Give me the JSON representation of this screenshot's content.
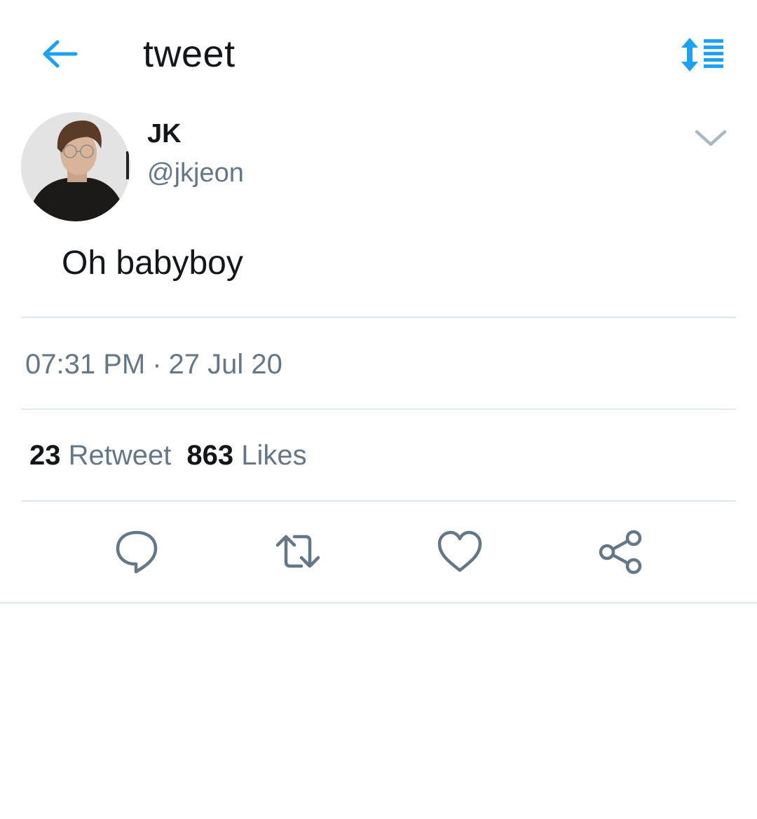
{
  "header": {
    "title": "tweet",
    "back_icon": "arrow-left-icon",
    "sort_icon": "sort-list-icon",
    "accent_color": "#1da1f2"
  },
  "author": {
    "name": "JK",
    "handle": "@jkjeon",
    "avatar_icon": "profile-photo",
    "menu_icon": "chevron-down-icon"
  },
  "tweet": {
    "text": "Oh babyboy",
    "time": "07:31 PM",
    "separator": "·",
    "date": "27 Jul 20"
  },
  "stats": {
    "retweets_count": "23",
    "retweets_label": "Retweet",
    "likes_count": "863",
    "likes_label": "Likes"
  },
  "actions": {
    "icons": [
      "reply-icon",
      "retweet-icon",
      "like-icon",
      "share-icon"
    ],
    "icon_color": "#657786"
  },
  "colors": {
    "text_primary": "#14171a",
    "text_secondary": "#657786",
    "divider": "#e1e8ed",
    "accent": "#1da1f2"
  }
}
